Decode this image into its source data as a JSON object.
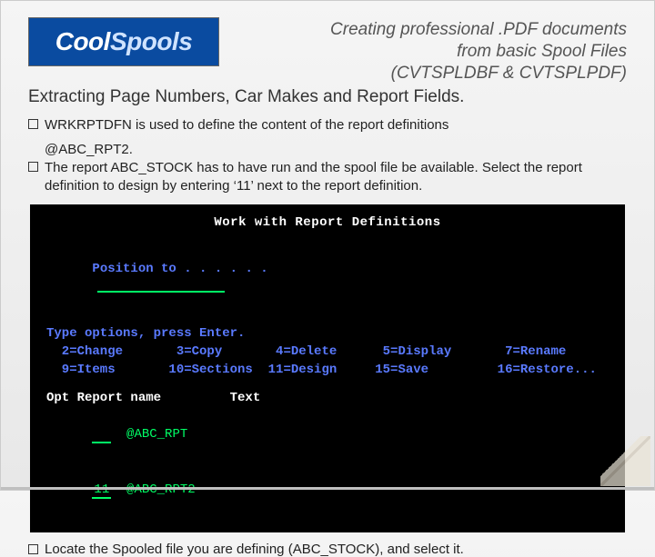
{
  "logo": {
    "part1": "Cool",
    "part2": "Spools"
  },
  "title": {
    "line1": "Creating professional .PDF documents",
    "line2": "from basic Spool Files",
    "line3": "(CVTSPLDBF & CVTSPLPDF)"
  },
  "subtitle": "Extracting Page Numbers, Car Makes and Report Fields.",
  "bullets": {
    "b1": "WRKRPTDFN is used to define the content of the report definitions",
    "b1_indent": "@ABC_RPT2.",
    "b2": "The report ABC_STOCK has to have run and the spool file be available. Select the report definition to design by entering ‘11’ next to the report definition."
  },
  "terminal": {
    "title": "Work with Report Definitions",
    "position_label": "Position to . . . . . .",
    "instr": "Type options, press Enter.",
    "opts_row1": "  2=Change       3=Copy       4=Delete      5=Display       7=Rename",
    "opts_row2": "  9=Items       10=Sections  11=Design     15=Save         16=Restore...",
    "cols": "Opt Report name         Text",
    "row1_opt": "  ",
    "row1_name": "@ABC_RPT",
    "row2_opt": "11",
    "row2_name": "@ABC_RPT2"
  },
  "footer": "Locate the Spooled file you are defining (ABC_STOCK), and select it."
}
